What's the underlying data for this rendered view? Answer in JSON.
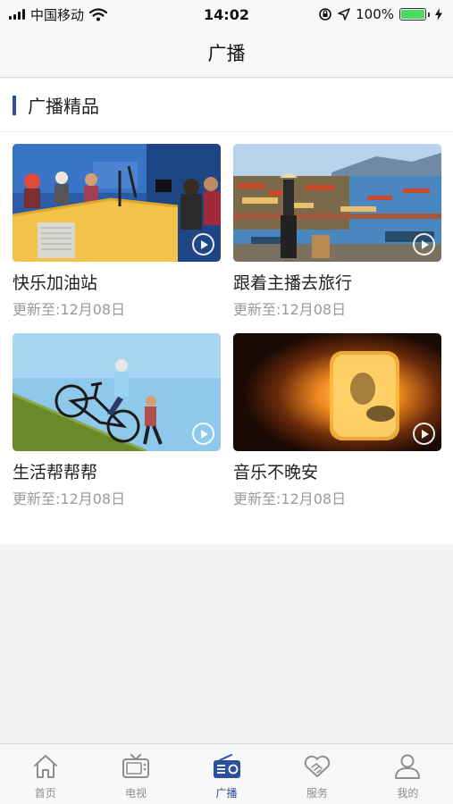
{
  "status_bar": {
    "carrier": "中国移动",
    "time": "14:02",
    "battery": "100%"
  },
  "header": {
    "title": "广播"
  },
  "section": {
    "title": "广播精品"
  },
  "programs": [
    {
      "title": "快乐加油站",
      "update": "更新至:12月08日",
      "image": "radio-studio"
    },
    {
      "title": "跟着主播去旅行",
      "update": "更新至:12月08日",
      "image": "harbor-travel"
    },
    {
      "title": "生活帮帮帮",
      "update": "更新至:12月08日",
      "image": "bicycle-hill"
    },
    {
      "title": "音乐不晚安",
      "update": "更新至:12月08日",
      "image": "glowing-lamp"
    }
  ],
  "tabbar": {
    "active": "广播",
    "items": [
      {
        "label": "首页",
        "icon": "home-icon"
      },
      {
        "label": "电视",
        "icon": "tv-icon"
      },
      {
        "label": "广播",
        "icon": "radio-icon"
      },
      {
        "label": "服务",
        "icon": "handshake-icon"
      },
      {
        "label": "我的",
        "icon": "user-icon"
      }
    ]
  },
  "colors": {
    "accent": "#2c4f9e",
    "inactive": "#8e8e8e",
    "battery": "#4cd964"
  }
}
